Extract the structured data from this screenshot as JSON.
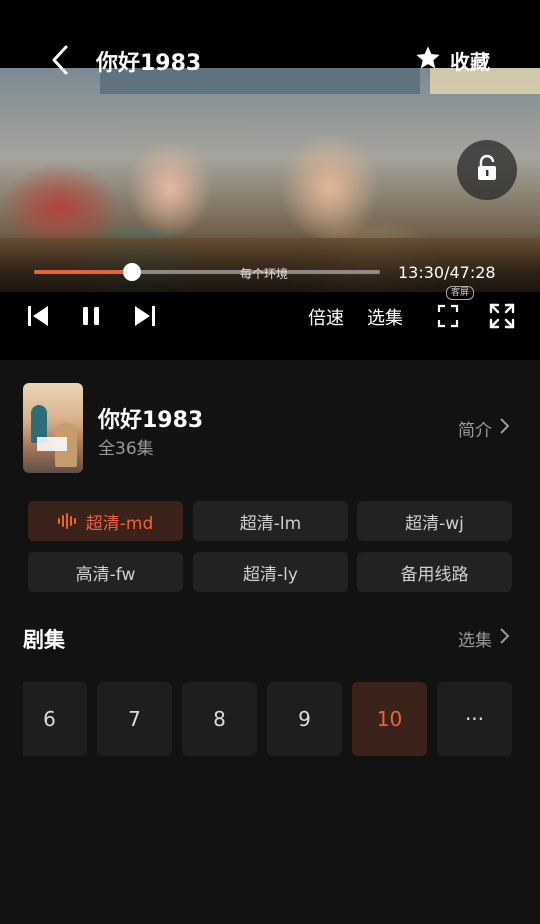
{
  "player": {
    "title": "你好1983",
    "favorite_label": "收藏",
    "subtitle": "每个环境",
    "time": "13:30/47:28",
    "progress_fraction": 0.283,
    "speed_label": "倍速",
    "episode_select_label": "选集",
    "cast_badge": "客屏"
  },
  "show": {
    "title": "你好1983",
    "episodes": "全36集",
    "intro_label": "简介"
  },
  "sources": [
    {
      "label": "超清-md",
      "active": true
    },
    {
      "label": "超清-lm",
      "active": false
    },
    {
      "label": "超清-wj",
      "active": false
    },
    {
      "label": "高清-fw",
      "active": false
    },
    {
      "label": "超清-ly",
      "active": false
    },
    {
      "label": "备用线路",
      "active": false
    }
  ],
  "episodes_section": {
    "title": "剧集",
    "select_label": "选集",
    "items": [
      {
        "label": "6",
        "active": false
      },
      {
        "label": "7",
        "active": false
      },
      {
        "label": "8",
        "active": false
      },
      {
        "label": "9",
        "active": false
      },
      {
        "label": "10",
        "active": true
      },
      {
        "label": "···",
        "active": false
      }
    ]
  },
  "colors": {
    "accent": "#e8643c",
    "background": "#121212",
    "chip": "#222222",
    "active_chip": "#3b221b"
  }
}
